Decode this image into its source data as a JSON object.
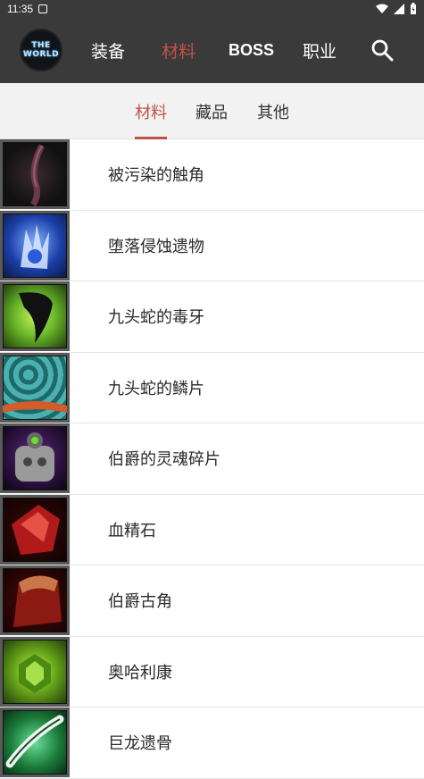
{
  "status": {
    "time": "11:35"
  },
  "header": {
    "logo_text_top": "THE",
    "logo_text_bottom": "WORLD",
    "nav": [
      {
        "label": "装备"
      },
      {
        "label": "材料"
      },
      {
        "label": "BOSS"
      },
      {
        "label": "职业"
      }
    ],
    "active_nav": "材料"
  },
  "sub_tabs": [
    {
      "label": "材料"
    },
    {
      "label": "藏品"
    },
    {
      "label": "其他"
    }
  ],
  "items": [
    {
      "label": "被污染的触角",
      "icon": "tainted-tentacle-icon",
      "colors": [
        "#1a1a1a",
        "#6a3a4a"
      ]
    },
    {
      "label": "堕落侵蚀遗物",
      "icon": "corrupted-relic-icon",
      "colors": [
        "#1b3fa8",
        "#7fb2ff"
      ]
    },
    {
      "label": "九头蛇的毒牙",
      "icon": "hydra-fang-icon",
      "colors": [
        "#6ab82a",
        "#111111"
      ]
    },
    {
      "label": "九头蛇的鳞片",
      "icon": "hydra-scale-icon",
      "colors": [
        "#2e8a8a",
        "#d65a2a"
      ]
    },
    {
      "label": "伯爵的灵魂碎片",
      "icon": "count-soul-shard-icon",
      "colors": [
        "#5a2a7a",
        "#9a9a9a"
      ]
    },
    {
      "label": "血精石",
      "icon": "bloodstone-icon",
      "colors": [
        "#b01a1a",
        "#ff6a5a"
      ]
    },
    {
      "label": "伯爵古角",
      "icon": "count-ancient-horn-icon",
      "colors": [
        "#8a1a12",
        "#c9774a"
      ]
    },
    {
      "label": "奥哈利康",
      "icon": "orichalcum-icon",
      "colors": [
        "#6aa81a",
        "#c6f05a"
      ]
    },
    {
      "label": "巨龙遗骨",
      "icon": "dragon-bone-icon",
      "colors": [
        "#1a7a3a",
        "#b6f0c6"
      ]
    }
  ]
}
